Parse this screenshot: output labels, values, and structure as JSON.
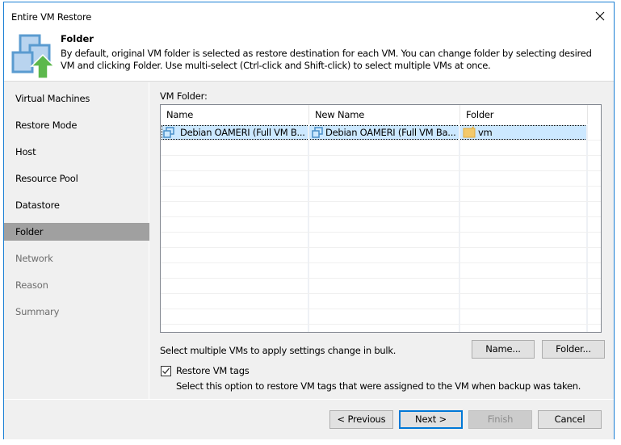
{
  "window": {
    "title": "Entire VM Restore",
    "close_icon": "close-icon"
  },
  "header": {
    "icon": "vm-restore-icon",
    "title": "Folder",
    "description": "By default, original VM folder is selected as restore destination for each VM. You can change folder by selecting desired VM and clicking Folder. Use multi-select (Ctrl-click and Shift-click) to select multiple VMs at once."
  },
  "sidebar": {
    "items": [
      {
        "label": "Virtual Machines",
        "state": "done"
      },
      {
        "label": "Restore Mode",
        "state": "done"
      },
      {
        "label": "Host",
        "state": "done"
      },
      {
        "label": "Resource Pool",
        "state": "done"
      },
      {
        "label": "Datastore",
        "state": "done"
      },
      {
        "label": "Folder",
        "state": "active"
      },
      {
        "label": "Network",
        "state": "disabled"
      },
      {
        "label": "Reason",
        "state": "disabled"
      },
      {
        "label": "Summary",
        "state": "disabled"
      }
    ]
  },
  "main": {
    "section_label": "VM Folder:",
    "grid": {
      "columns": [
        "Name",
        "New Name",
        "Folder"
      ],
      "rows": [
        {
          "name": "Debian OAMERI (Full VM B...",
          "new_name": "Debian OAMERI (Full VM Ba...",
          "folder": "vm",
          "selected": true,
          "name_icon": "vm-icon",
          "folder_icon": "folder-icon"
        }
      ]
    },
    "bulk_text": "Select multiple VMs to apply settings change in bulk.",
    "name_button": "Name...",
    "folder_button": "Folder...",
    "restore_tags": {
      "label": "Restore VM tags",
      "checked": true,
      "description": "Select this option to restore VM tags that were assigned to the VM when backup was taken."
    }
  },
  "footer": {
    "previous": "< Previous",
    "next": "Next >",
    "finish": "Finish",
    "cancel": "Cancel"
  }
}
